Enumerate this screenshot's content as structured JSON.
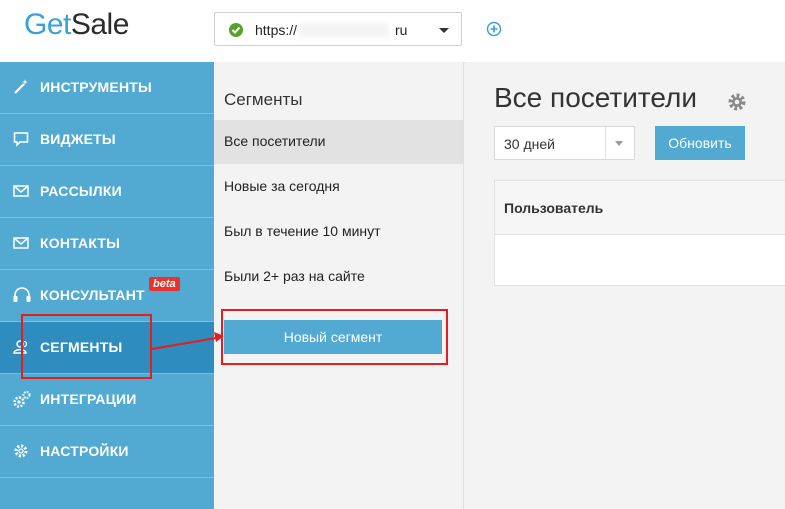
{
  "logo": {
    "part1": "Get",
    "part2": "Sale"
  },
  "site": {
    "prefix": "https://",
    "tld": "ru"
  },
  "sidebar": {
    "items": [
      {
        "label": "ИНСТРУМЕНТЫ",
        "icon": "magic-wand-icon"
      },
      {
        "label": "ВИДЖЕТЫ",
        "icon": "chat-bubble-icon"
      },
      {
        "label": "РАССЫЛКИ",
        "icon": "envelope-icon"
      },
      {
        "label": "КОНТАКТЫ",
        "icon": "envelope-icon"
      },
      {
        "label": "КОНСУЛЬТАНТ",
        "icon": "headset-icon",
        "badge": "beta"
      },
      {
        "label": "СЕГМЕНТЫ",
        "icon": "users-icon",
        "active": true
      },
      {
        "label": "ИНТЕГРАЦИИ",
        "icon": "gears-icon"
      },
      {
        "label": "НАСТРОЙКИ",
        "icon": "gear-icon"
      }
    ]
  },
  "segments": {
    "title": "Сегменты",
    "items": [
      {
        "label": "Все посетители",
        "active": true
      },
      {
        "label": "Новые за сегодня"
      },
      {
        "label": "Был в течение 10 минут"
      },
      {
        "label": "Были 2+ раз на сайте"
      }
    ],
    "new_button": "Новый сегмент"
  },
  "main": {
    "title": "Все посетители",
    "period": "30 дней",
    "refresh_button": "Обновить",
    "table": {
      "columns": [
        "Пользователь"
      ]
    }
  },
  "colors": {
    "accent": "#52aad2",
    "active": "#2f8cbf",
    "annotation": "#e41d1d",
    "check": "#5aa02c"
  }
}
